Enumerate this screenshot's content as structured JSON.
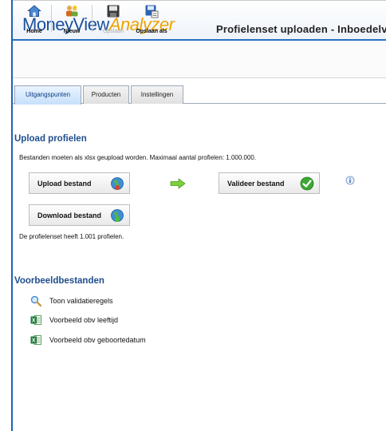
{
  "app": {
    "logo_part1": "MoneyView",
    "logo_part2": "Analyzer",
    "page_title": "Profielenset uploaden - Inboedelver"
  },
  "toolbar": {
    "home": "Home",
    "new": "Nieuw",
    "save": "Opslaan",
    "save_as": "Opslaan als"
  },
  "tabs": [
    "Uitgangspunten",
    "Producten",
    "Instellingen"
  ],
  "upload": {
    "heading": "Upload profielen",
    "instruction": "Bestanden moeten als xlsx geupload worden. Maximaal aantal profielen: 1.000.000.",
    "upload_button": "Upload bestand",
    "validate_button": "Valideer bestand",
    "download_button": "Download bestand",
    "status": "De profielenset heeft 1.001 profielen."
  },
  "examples": {
    "heading": "Voorbeeldbestanden",
    "items": [
      "Toon validatieregels",
      "Voorbeeld obv leeftijd",
      "Voorbeeld obv geboortedatum"
    ]
  },
  "colors": {
    "brand_blue": "#1a4f9c",
    "brand_orange": "#f0a300",
    "heading_blue": "#1f4e8c"
  }
}
